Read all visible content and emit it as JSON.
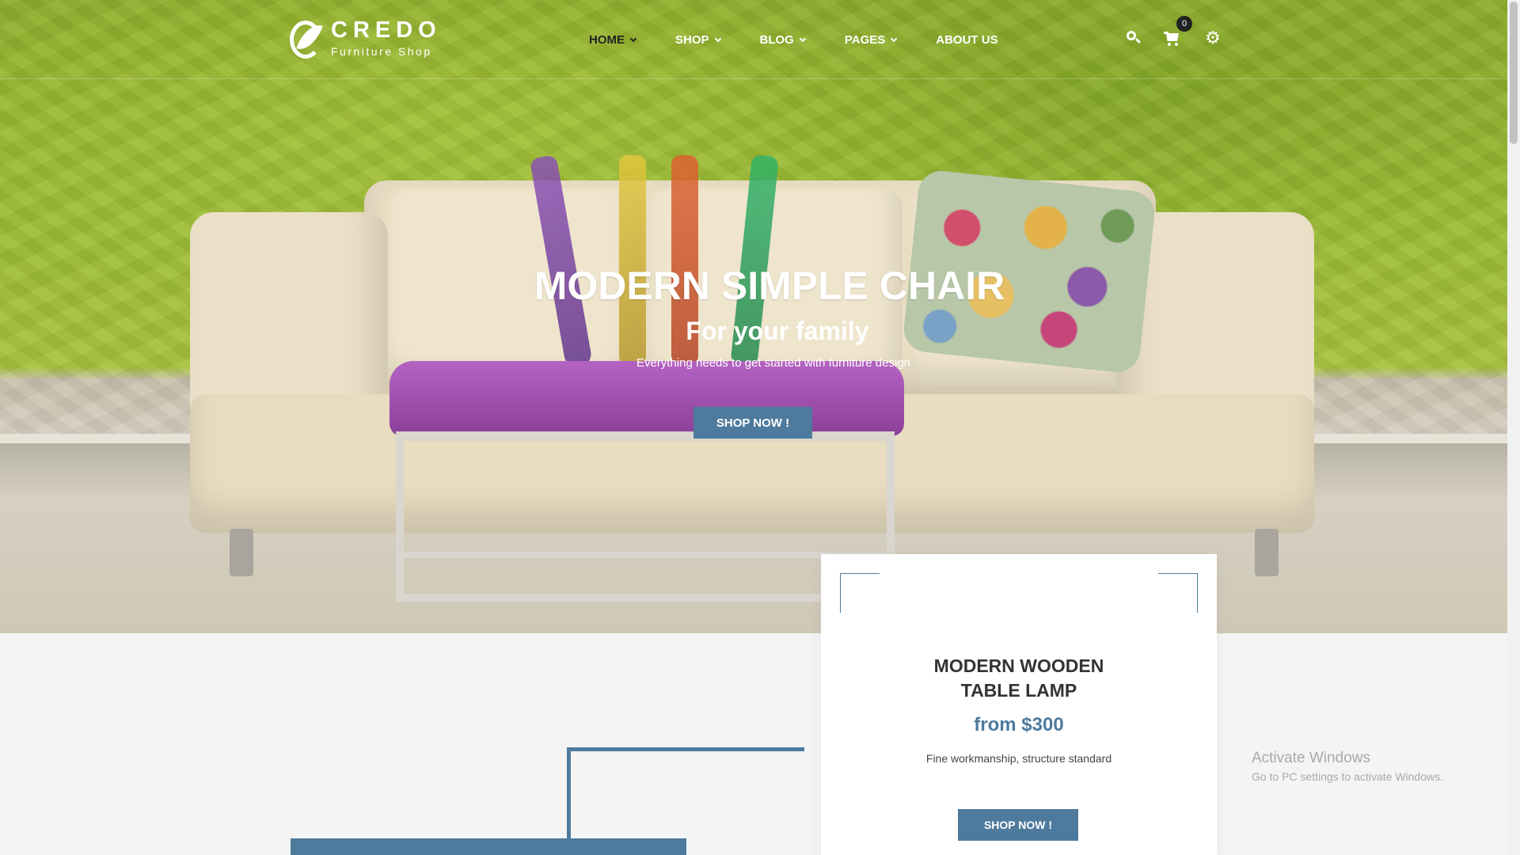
{
  "brand": {
    "title": "CREDO",
    "subtitle": "Furniture Shop"
  },
  "nav": {
    "items": [
      {
        "label": "HOME",
        "has_dropdown": true,
        "active": true
      },
      {
        "label": "SHOP",
        "has_dropdown": true,
        "active": false
      },
      {
        "label": "BLOG",
        "has_dropdown": true,
        "active": false
      },
      {
        "label": "PAGES",
        "has_dropdown": true,
        "active": false
      },
      {
        "label": "ABOUT US",
        "has_dropdown": false,
        "active": false
      }
    ]
  },
  "header_icons": {
    "search": "search-icon",
    "cart": "cart-icon",
    "cart_count": "0",
    "settings": "gear-icon"
  },
  "hero": {
    "title": "MODERN SIMPLE CHAIR",
    "subtitle": "For your family",
    "description": "Everything needs to get started with furniture design",
    "button_label": "SHOP NOW !"
  },
  "product_card": {
    "title_line1": "MODERN WOODEN",
    "title_line2": "TABLE LAMP",
    "price": "from $300",
    "description": "Fine workmanship, structure standard",
    "button_label": "SHOP NOW !"
  },
  "watermark": {
    "title": "Activate Windows",
    "subtitle": "Go to PC settings to activate Windows."
  },
  "colors": {
    "accent": "#4e7a9d",
    "wall": "#9cbc36",
    "text_dark": "#333333"
  }
}
